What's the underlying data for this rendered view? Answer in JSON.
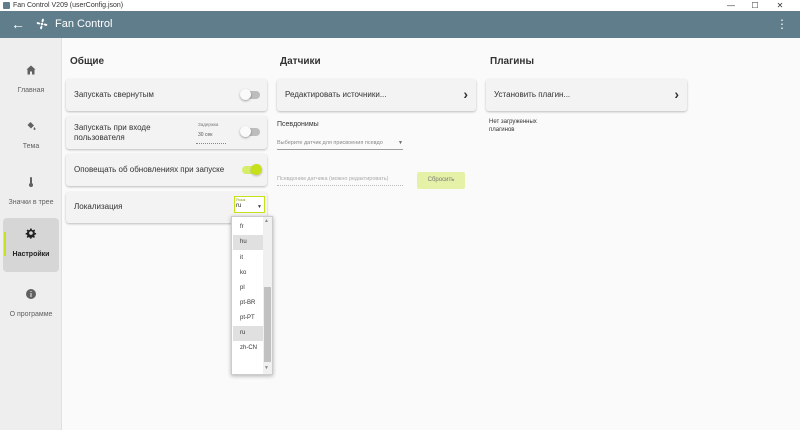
{
  "window": {
    "title": "Fan Control V209 (userConfig.json)",
    "minimize": "—",
    "maximize": "☐",
    "close": "✕"
  },
  "appbar": {
    "title": "Fan Control",
    "back": "←",
    "more": "⋮"
  },
  "sidebar": {
    "items": [
      {
        "label": "Главная",
        "icon": "home-icon"
      },
      {
        "label": "Тема",
        "icon": "paint-bucket-icon"
      },
      {
        "label": "Значки в трее",
        "icon": "thermometer-icon"
      },
      {
        "label": "Настройки",
        "icon": "gear-icon"
      },
      {
        "label": "О программе",
        "icon": "info-icon"
      }
    ],
    "active": "Настройки"
  },
  "general": {
    "title": "Общие",
    "start_minimized": "Запускать свернутым",
    "start_minimized_on": false,
    "start_with_login": "Запускать при входе пользователя",
    "start_with_login_on": false,
    "delay_label": "Задержка",
    "delay_value": "30 сек",
    "notify_updates": "Оповещать об обновлениях при запуске",
    "notify_updates_on": true,
    "localization": "Локализация",
    "locale_caption": "Язык",
    "locale_value": "ru",
    "locale_options": [
      "fr",
      "hu",
      "it",
      "ko",
      "pl",
      "pt-BR",
      "pt-PT",
      "ru",
      "zh-CN"
    ],
    "locale_hover": "hu",
    "locale_selected": "ru"
  },
  "sensors": {
    "title": "Датчики",
    "edit_sources": "Редактировать источники...",
    "aliases_label": "Псевдонимы",
    "sensor_select_placeholder": "Выберите датчик для присвоения псевдо",
    "alias_placeholder": "Псевдоним датчика (можно редактировать)",
    "reset": "Сбросить"
  },
  "plugins": {
    "title": "Плагины",
    "install": "Установить плагин...",
    "none_loaded": "Нет загруженных плагинов"
  },
  "colors": {
    "appbar": "#607d8b",
    "accent": "#c6e01c"
  }
}
